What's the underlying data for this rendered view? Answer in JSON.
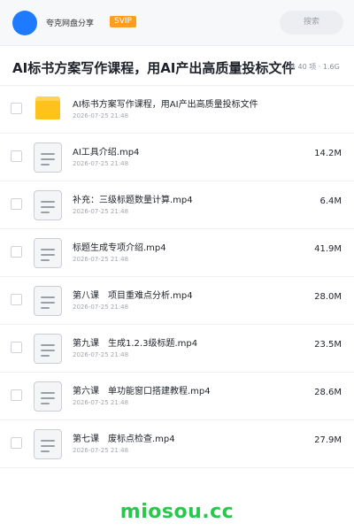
{
  "header": {
    "sharer_name": "夸克网盘分享",
    "badge": "SVIP",
    "search_label": "搜索"
  },
  "share": {
    "title": "AI标书方案写作课程，用AI产出高质量投标文件",
    "meta": "共 40 项 · 1.6G"
  },
  "items": [
    {
      "type": "folder",
      "name": "AI标书方案写作课程，用AI产出高质量投标文件",
      "date": "2026-07-25 21:48",
      "size": ""
    },
    {
      "type": "file",
      "name": "AI工具介绍.mp4",
      "date": "2026-07-25 21:48",
      "size": "14.2M"
    },
    {
      "type": "file",
      "name": "补充：三级标题数量计算.mp4",
      "date": "2026-07-25 21:48",
      "size": "6.4M"
    },
    {
      "type": "file",
      "name": "标题生成专项介绍.mp4",
      "date": "2026-07-25 21:48",
      "size": "41.9M"
    },
    {
      "type": "file",
      "name": "第八课　项目重难点分析.mp4",
      "date": "2026-07-25 21:48",
      "size": "28.0M"
    },
    {
      "type": "file",
      "name": "第九课　生成1.2.3级标题.mp4",
      "date": "2026-07-25 21:48",
      "size": "23.5M"
    },
    {
      "type": "file",
      "name": "第六课　单功能窗口搭建教程.mp4",
      "date": "2026-07-25 21:48",
      "size": "28.6M"
    },
    {
      "type": "file",
      "name": "第七课　废标点检查.mp4",
      "date": "2026-07-25 21:48",
      "size": "27.9M"
    }
  ],
  "footer": {
    "brand": "miosou.cc"
  },
  "colors": {
    "accent_blue": "#1e7bff",
    "svip_orange": "#ff9d1f",
    "folder_yellow": "#ffc21a",
    "brand_green": "#28c84b"
  }
}
